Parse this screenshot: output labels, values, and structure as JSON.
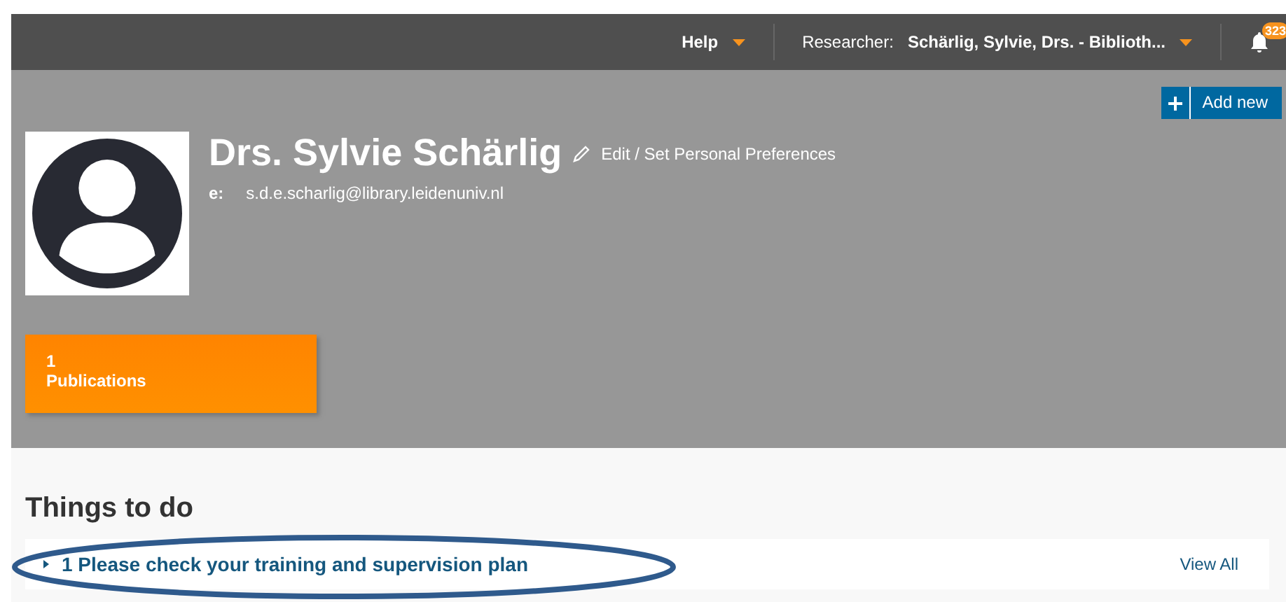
{
  "topbar": {
    "help": "Help",
    "researcher_label": "Researcher:",
    "researcher_name": "Schärlig, Sylvie, Drs. - Biblioth...",
    "notifications": "323"
  },
  "profile": {
    "add_new": "Add new",
    "name": "Drs. Sylvie Schärlig",
    "edit_link": "Edit / Set Personal Preferences",
    "email_label": "e:",
    "email": "s.d.e.scharlig@library.leidenuniv.nl"
  },
  "tiles": [
    {
      "count": "1",
      "label": "Publications"
    }
  ],
  "todo": {
    "title": "Things to do",
    "items": [
      {
        "text": "1 Please check your training and supervision plan",
        "expanded": false,
        "circled": true
      }
    ],
    "view_all": "View All"
  }
}
